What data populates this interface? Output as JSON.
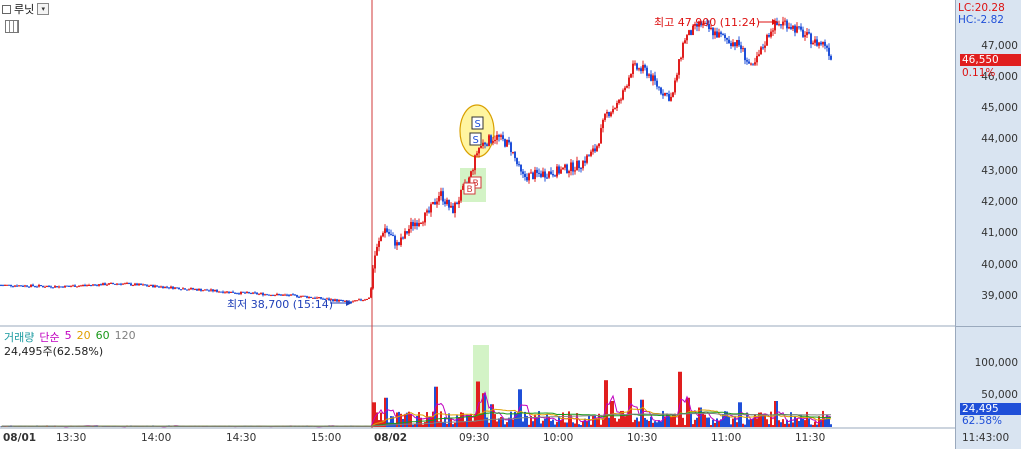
{
  "header": {
    "stock_name": "루닛",
    "dropdown_icon": "triangle-down"
  },
  "right_axis": {
    "lc": "LC:20.28",
    "hc": "HC:-2.82",
    "price_ticks": [
      "47,000",
      "46,000",
      "45,000",
      "44,000",
      "43,000",
      "42,000",
      "41,000",
      "40,000",
      "39,000"
    ],
    "current_price": "46,550",
    "change_pct": "0.11%",
    "volume_ticks": [
      "100,000",
      "50,000"
    ],
    "current_volume": "24,495",
    "volume_pct": "62.58%",
    "time_now": "11:43:00"
  },
  "annotations": {
    "high": "최고 47,900 (11:24)",
    "low": "최저 38,700 (15:14)",
    "signal_s": "S",
    "signal_b": "B"
  },
  "volume_legend": {
    "label": "거래량",
    "ma_label": "단순",
    "periods": [
      "5",
      "20",
      "60",
      "120"
    ],
    "info": "24,495주(62.58%)"
  },
  "time_axis": [
    "08/01",
    "13:30",
    "14:00",
    "14:30",
    "15:00",
    "08/02",
    "09:30",
    "10:00",
    "10:30",
    "11:00",
    "11:30"
  ],
  "colors": {
    "up": "#e01e1e",
    "down": "#1f4fd8",
    "ma5": "#c000c0",
    "ma20": "#e0a000",
    "ma60": "#1a9a1a",
    "ma120": "#808080"
  },
  "chart_data": {
    "type": "bar",
    "ylim": [
      38300,
      48100
    ],
    "high": 47900,
    "low": 38700,
    "close": 46550,
    "volume_ylim": [
      0,
      120000
    ]
  }
}
